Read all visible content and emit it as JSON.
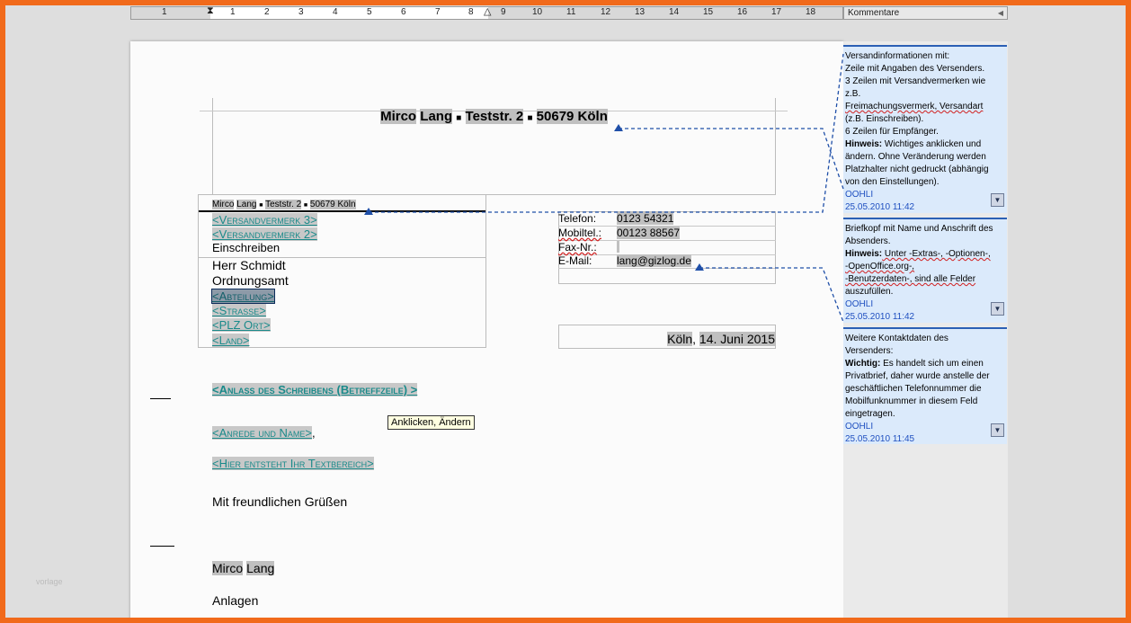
{
  "ruler": {
    "numbers": [
      "1",
      "1",
      "2",
      "3",
      "4",
      "5",
      "6",
      "7",
      "8",
      "9",
      "10",
      "11",
      "12",
      "13",
      "14",
      "15",
      "16",
      "17",
      "18"
    ]
  },
  "comments_pane": {
    "title": "Kommentare"
  },
  "document": {
    "sender_line": {
      "name": "Mirco",
      "surname": "Lang",
      "street": "Teststr. 2",
      "city": "50679 Köln"
    },
    "return_address": {
      "name": "Mirco",
      "surname": "Lang",
      "street": "Teststr. 2",
      "city": "50679 Köln"
    },
    "versand": {
      "v3": "<Versandvermerk 3>",
      "v2": "<Versandvermerk 2>",
      "v1": "Einschreiben"
    },
    "recipient": {
      "line1": "Herr Schmidt",
      "line2": "Ordnungsamt",
      "abteilung": "<Abteilung>",
      "strasse": "<Strasse>",
      "plz_ort": "<PLZ Ort>",
      "land": "<Land>"
    },
    "contact": [
      {
        "label": "Telefon:",
        "value": "0123 54321"
      },
      {
        "label": "Mobiltel.:",
        "value": "00123 88567"
      },
      {
        "label": "Fax-Nr.:",
        "value": ""
      },
      {
        "label": "E-Mail:",
        "value": "lang@gizlog.de"
      }
    ],
    "date": {
      "city": "Köln",
      "sep": ", ",
      "value": "14. Juni 2015"
    },
    "subject": "<Anlass des Schreibens (Betreffzeile) >",
    "salutation": "<Anrede und Name>",
    "salutation_comma": ",",
    "body": "<Hier entsteht Ihr Textbereich>",
    "closing": "Mit freundlichen Grüßen",
    "signature": {
      "first": "Mirco",
      "last": "Lang"
    },
    "attachments": "Anlagen"
  },
  "tooltip": "Anklicken, Ändern",
  "watermark": "vorlage",
  "comments": [
    {
      "l1": "Versandinformationen mit:",
      "l2": "Zeile mit Angaben des Versenders.",
      "l3": "3 Zeilen mit Versandvermerken wie",
      "l4": "z.B.",
      "l5": "Freimachungsvermerk, Versandart",
      "l6": "(z.B. Einschreiben).",
      "l7": "6 Zeilen für Empfänger.",
      "l8_bold": "Hinweis:",
      "l8": " Wichtiges anklicken und",
      "l9": "ändern. Ohne Veränderung werden",
      "l10": "Platzhalter nicht gedruckt (abhängig",
      "l11": "von den Einstellungen).",
      "author": "OOHLI",
      "date": "25.05.2010 11:42"
    },
    {
      "l1": "Briefkopf mit Name und Anschrift des",
      "l2": "Absenders.",
      "l3_bold": "Hinweis:",
      "l3": " Unter -Extras-, -Optionen-,",
      "l4": "-OpenOffice.org-,",
      "l5": "-Benutzerdaten-, sind alle Felder",
      "l6": "auszufüllen.",
      "author": "OOHLI",
      "date": "25.05.2010 11:42"
    },
    {
      "l1": "Weitere Kontaktdaten des",
      "l2": "Versenders:",
      "l3_bold": "Wichtig:",
      "l3": " Es handelt sich um einen",
      "l4": "Privatbrief, daher wurde anstelle der",
      "l5": "geschäftlichen Telefonnummer die",
      "l6": "Mobilfunknummer in diesem Feld",
      "l7": "eingetragen.",
      "author": "OOHLI",
      "date": "25.05.2010 11:45"
    }
  ],
  "colors": {
    "frame": "#f16a1b",
    "comment_bg": "#dbeafb",
    "connector": "#1f4fa8",
    "field_text": "#1a8a8a"
  }
}
